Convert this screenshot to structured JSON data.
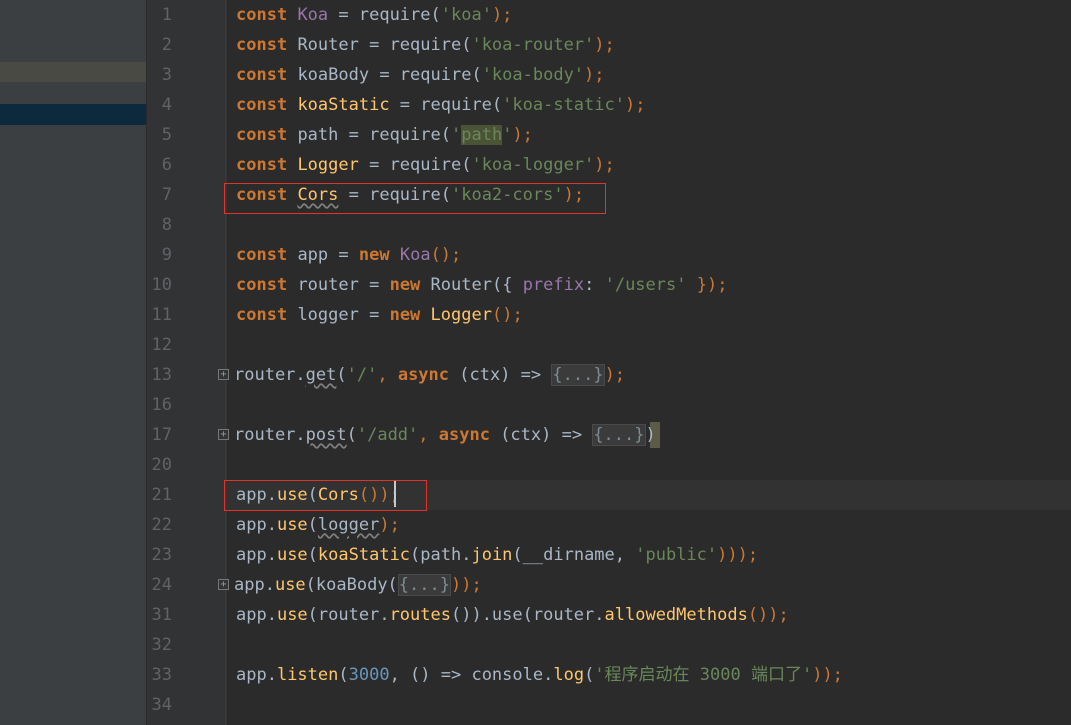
{
  "editor": {
    "line_numbers": [
      "1",
      "2",
      "3",
      "4",
      "5",
      "6",
      "7",
      "8",
      "9",
      "10",
      "11",
      "12",
      "13",
      "16",
      "17",
      "20",
      "21",
      "22",
      "23",
      "24",
      "31",
      "32",
      "33",
      "34"
    ],
    "lines": {
      "l1": {
        "kw": "const",
        "name": "Koa",
        "eq": " = require(",
        "str": "'koa'",
        "end": ");"
      },
      "l2": {
        "kw": "const",
        "name": "Router",
        "eq": " = require(",
        "str": "'koa-router'",
        "end": ");"
      },
      "l3": {
        "kw": "const",
        "name": "koaBody",
        "eq": " = require(",
        "str": "'koa-body'",
        "end": ");"
      },
      "l4": {
        "kw": "const",
        "name": "koaStatic",
        "eq": " = require(",
        "str": "'koa-static'",
        "end": ");"
      },
      "l5": {
        "kw": "const",
        "name": "path",
        "eq": " = require(",
        "str_q1": "'",
        "str_inner": "path",
        "str_q2": "'",
        "end": ");"
      },
      "l6": {
        "kw": "const",
        "name": "Logger",
        "eq": " = require(",
        "str": "'koa-logger'",
        "end": ");"
      },
      "l7": {
        "kw": "const",
        "name": "Cors",
        "eq": " = require(",
        "str": "'koa2-cors'",
        "end": ");"
      },
      "l9": {
        "kw": "const",
        "name": "app",
        "eq": " = ",
        "kw2": "new",
        "cls": "Koa",
        "end": "();"
      },
      "l10": {
        "kw": "const",
        "name": "router",
        "eq": " = ",
        "kw2": "new",
        "cls": "Router",
        "open": "({ ",
        "prop": "prefix",
        "colon": ": ",
        "str": "'/users'",
        "end": " });"
      },
      "l11": {
        "kw": "const",
        "name": "logger",
        "eq": " = ",
        "kw2": "new",
        "cls": "Logger",
        "end": "();"
      },
      "l13": {
        "obj": "router.",
        "meth": "get",
        "open": "(",
        "str": "'/'",
        "comma": ", ",
        "kw": "async",
        "args": " (ctx) => ",
        "fold": "{...}",
        "end": ");"
      },
      "l17": {
        "obj": "router.",
        "meth": "post",
        "open": "(",
        "str": "'/add'",
        "comma": ", ",
        "kw": "async",
        "args": " (ctx) => ",
        "fold": "{...}",
        "end": ")"
      },
      "l21": {
        "obj": "app.",
        "meth": "use",
        "open": "(",
        "call": "Cors",
        "end": "());"
      },
      "l22": {
        "obj": "app.",
        "meth": "use",
        "open": "(",
        "arg": "logger",
        "end": ");"
      },
      "l23": {
        "obj": "app.",
        "meth": "use",
        "open": "(",
        "call": "koaStatic",
        "p1": "(path.",
        "m2": "join",
        "p2": "(__dirname, ",
        "str": "'public'",
        "end": ")));"
      },
      "l24": {
        "obj": "app.",
        "meth": "use",
        "open": "(koaBody(",
        "fold": "{...}",
        "end": "));"
      },
      "l31": {
        "obj": "app.",
        "meth": "use",
        "open": "(router.",
        "m2": "routes",
        "mid": "()).use(router.",
        "m3": "allowedMethods",
        "end": "());"
      },
      "l33": {
        "obj": "app.",
        "meth": "listen",
        "open": "(",
        "num": "3000",
        "comma": ", () => console.",
        "m2": "log",
        "p": "(",
        "str": "'程序启动在 3000 端口了'",
        "end": "));"
      }
    }
  },
  "colors": {
    "background": "#2b2b2b",
    "keyword": "#cc7832",
    "string": "#6a8759",
    "function": "#ffc66d",
    "property": "#9876aa",
    "number": "#6897bb",
    "text": "#a9b7c6",
    "annotation_box": "#e0332e"
  }
}
